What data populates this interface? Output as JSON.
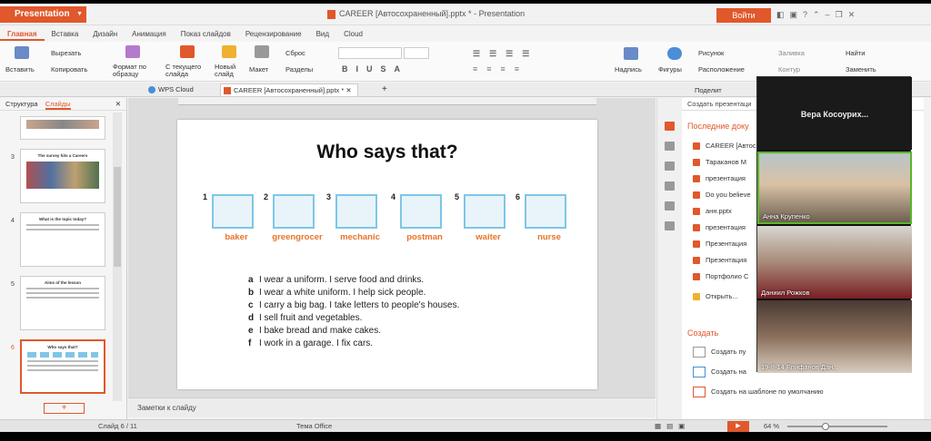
{
  "app": {
    "name": "Presentation",
    "doc_title": "CAREER [Автосохраненный].pptx * - Presentation",
    "login": "Войти"
  },
  "menu_tabs": [
    "Главная",
    "Вставка",
    "Дизайн",
    "Анимация",
    "Показ слайдов",
    "Рецензирование",
    "Вид",
    "Cloud"
  ],
  "ribbon": {
    "insert": "Вставить",
    "cut": "Вырезать",
    "copy": "Копировать",
    "format_painter": "Формат по образцу",
    "from_current": "С текущего слайда",
    "new_slide": "Новый слайд",
    "layout": "Макет",
    "reset": "Сброс",
    "sections": "Разделы",
    "inscription": "Надпись",
    "shapes": "Фигуры",
    "arrangement": "Расположение",
    "shape_fill": "Заливка",
    "outline": "Контур",
    "picture": "Рисунок",
    "find": "Найти",
    "replace": "Заменить"
  },
  "tabs": {
    "wps_cloud": "WPS Cloud",
    "doc": "CAREER [Автосохраненный].pptx *"
  },
  "left_panel": {
    "tab_structure": "Структура",
    "tab_slides": "Слайды"
  },
  "thumbnails": [
    {
      "num": "",
      "title": ""
    },
    {
      "num": "3",
      "title": "The survey hits a Careers"
    },
    {
      "num": "4",
      "title": "What is the topic today?"
    },
    {
      "num": "5",
      "title": "Aims of the lesson"
    },
    {
      "num": "6",
      "title": "Who says that?"
    }
  ],
  "slide": {
    "title": "Who says that?",
    "jobs": [
      {
        "n": "1",
        "label": "baker"
      },
      {
        "n": "2",
        "label": "greengrocer"
      },
      {
        "n": "3",
        "label": "mechanic"
      },
      {
        "n": "4",
        "label": "postman"
      },
      {
        "n": "5",
        "label": "waiter"
      },
      {
        "n": "6",
        "label": "nurse"
      }
    ],
    "sentences": [
      {
        "l": "a",
        "t": "I wear a uniform. I serve food and drinks."
      },
      {
        "l": "b",
        "t": "I wear a white uniform. I help sick people."
      },
      {
        "l": "c",
        "t": "I carry a big bag. I take letters to people's houses."
      },
      {
        "l": "d",
        "t": "I sell fruit and vegetables."
      },
      {
        "l": "e",
        "t": "I bake bread and make cakes."
      },
      {
        "l": "f",
        "t": "I work in a garage. I fix cars."
      }
    ]
  },
  "notes_placeholder": "Заметки к слайду",
  "right_panel": {
    "header": "Создать презентаци",
    "share": "Поделит",
    "recent_title": "Последние доку",
    "recent": [
      "CAREER [Автос",
      "Тараканов М",
      "презентация",
      "Do you believe",
      "анн.pptx",
      "презентация",
      "Презентация",
      "Презентация",
      "Портфолио С"
    ],
    "open": "Открыть...",
    "create_title": "Создать",
    "create": [
      "Создать пу",
      "Создать на",
      "Создать на шаблоне по умолчанию"
    ]
  },
  "status": {
    "slide": "Слайд 6 / 11",
    "theme": "Тема Office",
    "zoom": "64 %"
  },
  "video": {
    "host": "Вера  Косоурих...",
    "participants": [
      "Анна Крупенко",
      "Даниил Рожков",
      "19-8-14 Епифанов Дан..."
    ]
  }
}
